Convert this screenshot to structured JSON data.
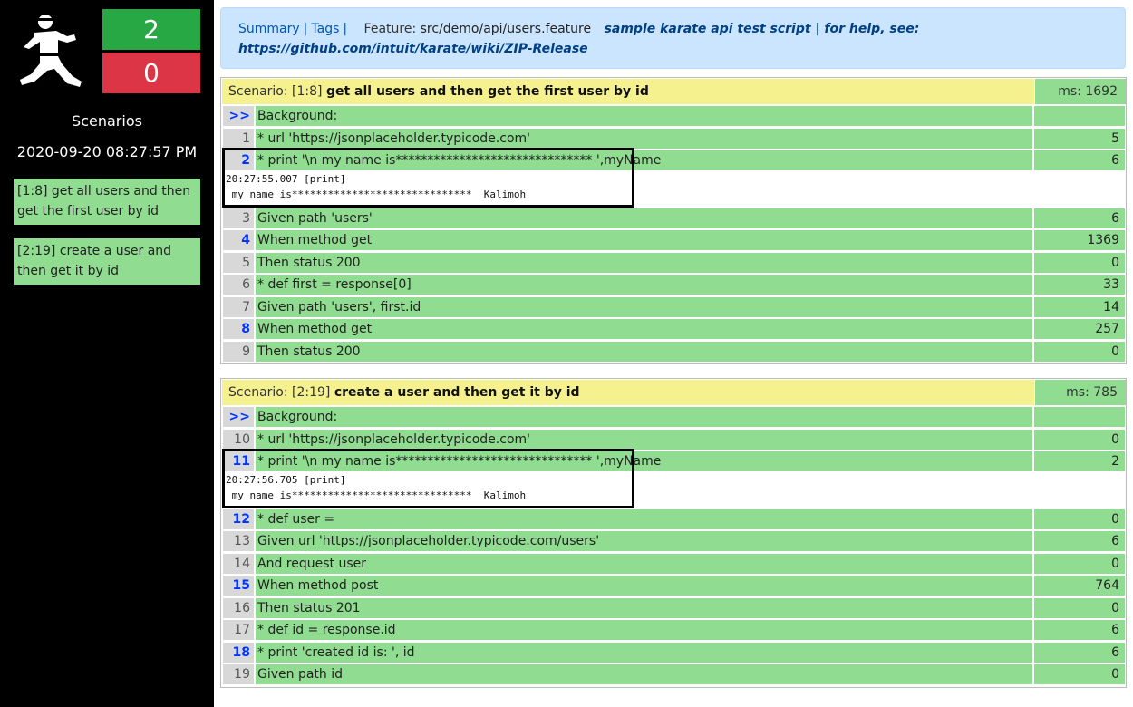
{
  "sidebar": {
    "logo": "karate-figure-icon",
    "passed": "2",
    "failed": "0",
    "heading": "Scenarios",
    "date": "2020-09-20 08:27:57 PM",
    "scenarios": [
      "[1:8] get all users and then get the first user by id",
      "[2:19] create a user and then get it by id"
    ]
  },
  "header": {
    "summary_link": "Summary",
    "separator": "|",
    "tags_link": "Tags",
    "feature_label": "Feature:",
    "feature_path": "src/demo/api/users.feature",
    "description": "sample karate api test script | for help, see: https://github.com/intuit/karate/wiki/ZIP-Release"
  },
  "scenarios": [
    {
      "prefix": "Scenario: [1:8]",
      "name": "get all users and then get the first user by id",
      "ms": "ms: 1692",
      "background_marker": ">>",
      "background_text": "Background:",
      "steps": [
        {
          "line": "1",
          "text": "* url 'https://jsonplaceholder.typicode.com'",
          "ms": "5",
          "highlight": false
        },
        {
          "line": "2",
          "text": "* print '\\n my name is******************************* ',myName",
          "ms": "6",
          "highlight": true
        },
        {
          "line": "3",
          "text": "Given path 'users'",
          "ms": "6",
          "highlight": false
        },
        {
          "line": "4",
          "text": "When method get",
          "ms": "1369",
          "highlight": true
        },
        {
          "line": "5",
          "text": "Then status 200",
          "ms": "0",
          "highlight": false
        },
        {
          "line": "6",
          "text": "* def first = response[0]",
          "ms": "33",
          "highlight": false
        },
        {
          "line": "7",
          "text": "Given path 'users', first.id",
          "ms": "14",
          "highlight": false
        },
        {
          "line": "8",
          "text": "When method get",
          "ms": "257",
          "highlight": true
        },
        {
          "line": "9",
          "text": "Then status 200",
          "ms": "0",
          "highlight": false
        }
      ],
      "log": {
        "time": "20:27:55.007 [print]",
        "text": " my name is******************************  Kalimoh"
      }
    },
    {
      "prefix": "Scenario: [2:19]",
      "name": "create a user and then get it by id",
      "ms": "ms: 785",
      "background_marker": ">>",
      "background_text": "Background:",
      "steps": [
        {
          "line": "10",
          "text": "* url 'https://jsonplaceholder.typicode.com'",
          "ms": "0",
          "highlight": false
        },
        {
          "line": "11",
          "text": "* print '\\n my name is******************************* ',myName",
          "ms": "2",
          "highlight": true
        },
        {
          "line": "12",
          "text": "* def user =",
          "ms": "0",
          "highlight": true
        },
        {
          "line": "13",
          "text": "Given url 'https://jsonplaceholder.typicode.com/users'",
          "ms": "6",
          "highlight": false
        },
        {
          "line": "14",
          "text": "And request user",
          "ms": "0",
          "highlight": false
        },
        {
          "line": "15",
          "text": "When method post",
          "ms": "764",
          "highlight": true
        },
        {
          "line": "16",
          "text": "Then status 201",
          "ms": "0",
          "highlight": false
        },
        {
          "line": "17",
          "text": "* def id = response.id",
          "ms": "6",
          "highlight": false
        },
        {
          "line": "18",
          "text": "* print 'created id is: ', id",
          "ms": "6",
          "highlight": true
        },
        {
          "line": "19",
          "text": "Given path id",
          "ms": "0",
          "highlight": false
        }
      ],
      "log": {
        "time": "20:27:56.705 [print]",
        "text": " my name is******************************  Kalimoh"
      }
    }
  ]
}
